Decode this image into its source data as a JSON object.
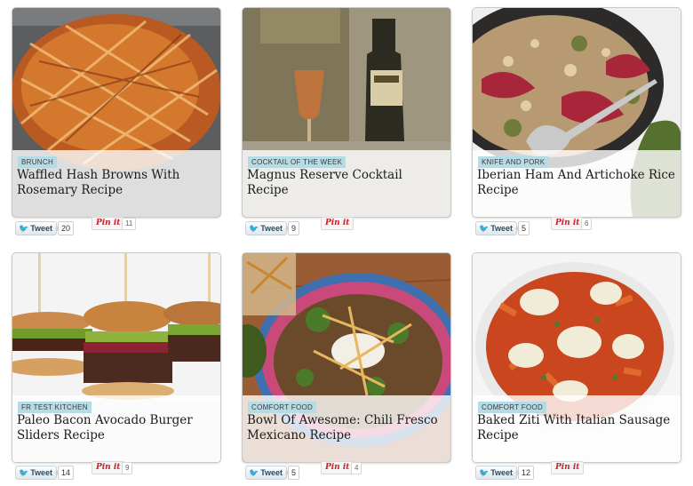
{
  "cards": [
    {
      "category": "BRUNCH",
      "title": "Waffled Hash Browns With Rosemary Recipe",
      "tweet_label": "Tweet",
      "tweet_count": "20",
      "pin_label": "Pin it",
      "pin_count": "11"
    },
    {
      "category": "COCKTAIL OF THE WEEK",
      "title": "Magnus Reserve Cocktail Recipe",
      "tweet_label": "Tweet",
      "tweet_count": "9",
      "pin_label": "Pin it",
      "pin_count": ""
    },
    {
      "category": "KNIFE AND PORK",
      "title": "Iberian Ham And Artichoke Rice Recipe",
      "tweet_label": "Tweet",
      "tweet_count": "5",
      "pin_label": "Pin it",
      "pin_count": "6"
    },
    {
      "category": "FR TEST KITCHEN",
      "title": "Paleo Bacon Avocado Burger Sliders Recipe",
      "tweet_label": "Tweet",
      "tweet_count": "14",
      "pin_label": "Pin it",
      "pin_count": "9"
    },
    {
      "category": "COMFORT FOOD",
      "title": "Bowl Of Awesome: Chili Fresco Mexicano Recipe",
      "tweet_label": "Tweet",
      "tweet_count": "5",
      "pin_label": "Pin it",
      "pin_count": "4"
    },
    {
      "category": "COMFORT FOOD",
      "title": "Baked Ziti With Italian Sausage Recipe",
      "tweet_label": "Tweet",
      "tweet_count": "12",
      "pin_label": "Pin it",
      "pin_count": ""
    }
  ],
  "colors": {
    "tag_bg": "#b7dbe4",
    "pin_red": "#c8232c",
    "twitter_blue": "#2aa9e0"
  },
  "icons": {
    "tweet": "twitter-bird-icon"
  }
}
